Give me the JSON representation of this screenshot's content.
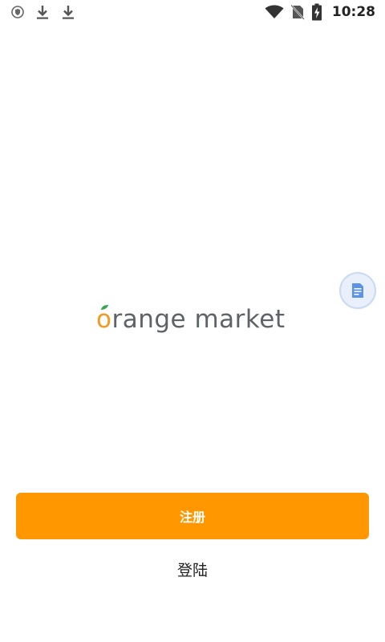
{
  "status_bar": {
    "time": "10:28",
    "icons": [
      "shield-icon",
      "download-icon",
      "download-icon",
      "wifi-icon",
      "no-sim-icon",
      "battery-charging-icon"
    ]
  },
  "logo": {
    "first_letter": "o",
    "rest": "range market",
    "accent_color": "#f39a1e",
    "text_color": "#5f6268"
  },
  "floating_button": {
    "icon": "document-icon"
  },
  "actions": {
    "register_label": "注册",
    "login_label": "登陆",
    "primary_color": "#ff9700"
  }
}
